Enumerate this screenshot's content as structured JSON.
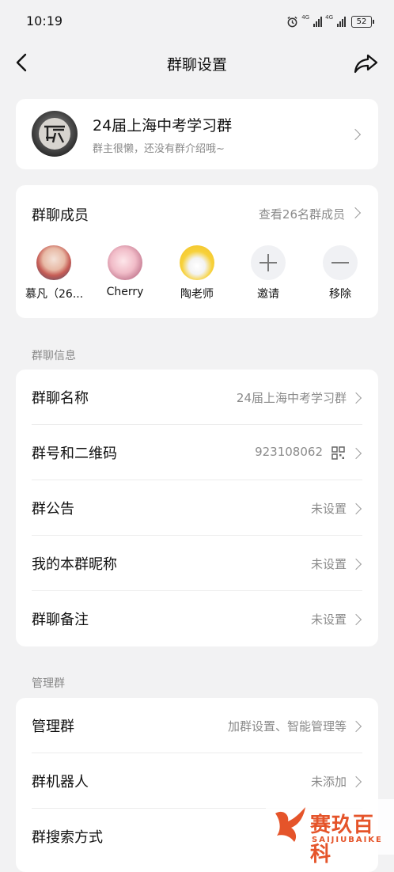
{
  "status_bar": {
    "time": "10:19",
    "network1": "4G",
    "network2": "4G",
    "battery": "52"
  },
  "nav": {
    "title": "群聊设置"
  },
  "group_header": {
    "name": "24届上海中考学习群",
    "description": "群主很懒，还没有群介绍哦~"
  },
  "members_card": {
    "title": "群聊成员",
    "view_all": "查看26名群成员",
    "members": [
      {
        "name": "慕凡（26..."
      },
      {
        "name": "Cherry"
      },
      {
        "name": "陶老师"
      }
    ],
    "invite_label": "邀请",
    "remove_label": "移除"
  },
  "info_section": {
    "label": "群聊信息",
    "rows": [
      {
        "label": "群聊名称",
        "value": "24届上海中考学习群"
      },
      {
        "label": "群号和二维码",
        "value": "923108062"
      },
      {
        "label": "群公告",
        "value": "未设置"
      },
      {
        "label": "我的本群昵称",
        "value": "未设置"
      },
      {
        "label": "群聊备注",
        "value": "未设置"
      }
    ]
  },
  "manage_section": {
    "label": "管理群",
    "rows": [
      {
        "label": "管理群",
        "value": "加群设置、智能管理等"
      },
      {
        "label": "群机器人",
        "value": "未添加"
      },
      {
        "label": "群搜索方式",
        "value": ""
      }
    ]
  },
  "watermark": {
    "text_cn": "赛玖百科",
    "text_en": "SAIJIUBAIKE"
  },
  "colors": {
    "background": "#f2f2f3",
    "card": "#ffffff",
    "secondary_text": "#8a8a8a",
    "watermark": "#e5542a"
  }
}
